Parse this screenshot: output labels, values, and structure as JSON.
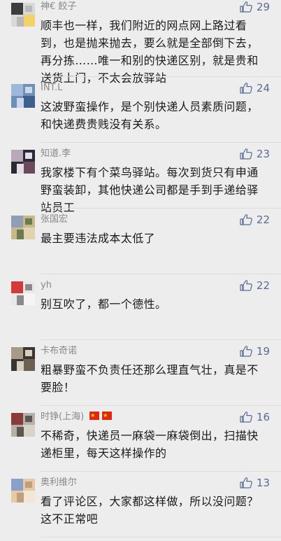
{
  "comments": [
    {
      "name": "神€ 餃子",
      "likes": "29",
      "text": "顺丰也一样，我们附近的网点网上路过看到，也是抛来抛去，要么就是全部倒下去，再分拣……唯一和别的快递区别，就是贵和送货上门，不太会放驿站",
      "flags": false,
      "avatar_colors": [
        "#d9d9d9",
        "#3d3d3d",
        "#f2d36b",
        "#b9b9b9"
      ]
    },
    {
      "name": "INT.L",
      "likes": "24",
      "text": "这波野蛮操作，是个别快递人员素质问题，和快递费贵贱没有关系。",
      "flags": false,
      "avatar_colors": [
        "#6f8fb8",
        "#9db8d8",
        "#3e5f8c",
        "#c9d8ea"
      ]
    },
    {
      "name": "知道.李",
      "likes": "23",
      "text": "我家楼下有个菜鸟驿站。每次到货只有申通野蛮装卸，其他快递公司都是手到手递给驿站员工",
      "flags": false,
      "avatar_colors": [
        "#2a2a35",
        "#b8a8b8",
        "#6b4a5e",
        "#e5dde5"
      ]
    },
    {
      "name": "张国宏",
      "likes": "22",
      "text": "最主要违法成本太低了",
      "flags": false,
      "avatar_colors": [
        "#c9b98a",
        "#8f9fb5",
        "#e0d3b0",
        "#6c7a52"
      ]
    },
    {
      "name": "yh",
      "likes": "22",
      "text": "别互吹了，都一个德性。",
      "flags": false,
      "avatar_colors": [
        "#e8e8e8",
        "#d23a3a",
        "#f5f5f5",
        "#8a8a8a"
      ]
    },
    {
      "name": "卡布奇诺",
      "likes": "19",
      "text": "粗暴野蛮不负责任还那么理直气壮，真是不要脸！",
      "flags": false,
      "avatar_colors": [
        "#3b3530",
        "#a89a88",
        "#6d5f52",
        "#d8cfc4"
      ]
    },
    {
      "name": "时铮(上海)",
      "likes": "16",
      "text": "不稀奇，快递员一麻袋一麻袋倒出，扫描快递柜里，每天这样操作的",
      "flags": true,
      "avatar_colors": [
        "#b7b0a8",
        "#8a3a3a",
        "#d9d2c8",
        "#5a5650"
      ]
    },
    {
      "name": "奥利维尔",
      "likes": "13",
      "text": "看了评论区，大家都这样做，所以没问题？这不正常吧",
      "flags": false,
      "avatar_colors": [
        "#e7c9a8",
        "#8aa0c8",
        "#f3e6d6",
        "#c0a07a"
      ]
    }
  ]
}
